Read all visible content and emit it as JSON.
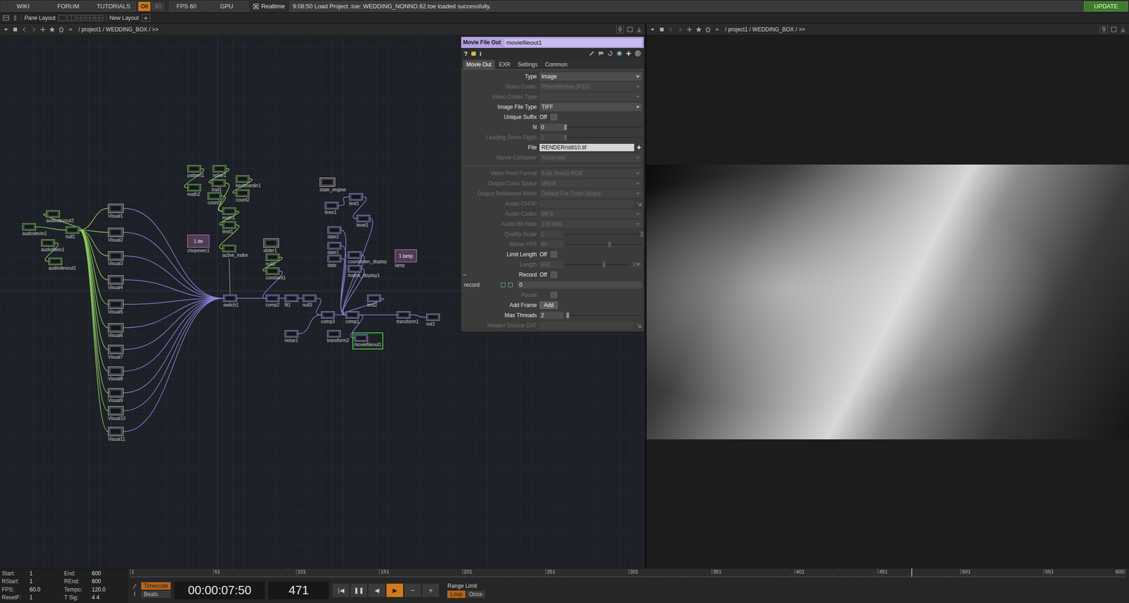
{
  "menubar": {
    "items": [
      {
        "label": "WIKI"
      },
      {
        "label": "FORUM"
      },
      {
        "label": "TUTORIALS"
      }
    ],
    "perf": {
      "badge": "OII",
      "dim": "60"
    },
    "fps": "FPS 60",
    "gpu": "GPU",
    "realtime": {
      "label": "Realtime",
      "checked": true
    },
    "status": "9:08:50 Load Project .toe: WEDDING_NONNO.62.toe loaded successfully.",
    "update": "UPDATE"
  },
  "toolbar": {
    "pane_layout": "Pane Layout",
    "new_layout": "New Layout",
    "add": "+"
  },
  "panes": [
    {
      "path": "/ project1 / WEDDING_BOX / >>",
      "counter": "0"
    },
    {
      "path": "/ project1 / WEDDING_BOX / >>",
      "counter": "0"
    }
  ],
  "network": {
    "nodes": [
      {
        "name": "audiodevout2",
        "kind": "chop",
        "selected": false
      },
      {
        "name": "audiodevin1",
        "kind": "chop",
        "selected": false
      },
      {
        "name": "null1",
        "kind": "chop",
        "selected": false
      },
      {
        "name": "audiofilein1",
        "kind": "chop",
        "selected": false
      },
      {
        "name": "audiodevout1",
        "kind": "chop",
        "selected": false
      },
      {
        "name": "Visual1",
        "kind": "comp",
        "selected": false
      },
      {
        "name": "Visual2",
        "kind": "comp",
        "selected": false
      },
      {
        "name": "Visual3",
        "kind": "comp",
        "selected": false
      },
      {
        "name": "Visual4",
        "kind": "comp",
        "selected": false
      },
      {
        "name": "Visual5",
        "kind": "comp",
        "selected": false
      },
      {
        "name": "Visual6",
        "kind": "comp",
        "selected": false
      },
      {
        "name": "Visual7",
        "kind": "comp",
        "selected": false
      },
      {
        "name": "Visual8",
        "kind": "comp",
        "selected": false
      },
      {
        "name": "Visual9",
        "kind": "comp",
        "selected": false
      },
      {
        "name": "Visual10",
        "kind": "comp",
        "selected": false
      },
      {
        "name": "Visual11",
        "kind": "comp",
        "selected": false
      },
      {
        "name": "pattern1",
        "kind": "chop",
        "selected": false
      },
      {
        "name": "noise1",
        "kind": "chop",
        "selected": false
      },
      {
        "name": "math2",
        "kind": "chop",
        "selected": false
      },
      {
        "name": "trail1",
        "kind": "chop",
        "selected": false
      },
      {
        "name": "keyboardin1",
        "kind": "chop",
        "selected": false
      },
      {
        "name": "count1",
        "kind": "chop",
        "selected": false
      },
      {
        "name": "count2",
        "kind": "chop",
        "selected": false
      },
      {
        "name": "math1",
        "kind": "chop",
        "selected": false
      },
      {
        "name": "limit1",
        "kind": "chop",
        "selected": false
      },
      {
        "name": "chopexec1",
        "kind": "dat",
        "selected": false,
        "viewer": "1 de"
      },
      {
        "name": "active_index",
        "kind": "chop",
        "selected": false
      },
      {
        "name": "slider1",
        "kind": "comp",
        "selected": false
      },
      {
        "name": "null2",
        "kind": "chop",
        "selected": false
      },
      {
        "name": "constant1",
        "kind": "chop",
        "selected": false
      },
      {
        "name": "switch1",
        "kind": "top",
        "selected": false
      },
      {
        "name": "comp2",
        "kind": "top",
        "selected": false
      },
      {
        "name": "fit1",
        "kind": "top",
        "selected": false
      },
      {
        "name": "null3",
        "kind": "top",
        "selected": false
      },
      {
        "name": "comp3",
        "kind": "top",
        "selected": false
      },
      {
        "name": "comp1",
        "kind": "top",
        "selected": false
      },
      {
        "name": "noise1",
        "kind": "top",
        "selected": false
      },
      {
        "name": "transform2",
        "kind": "top",
        "selected": false
      },
      {
        "name": "moviefileout1",
        "kind": "top",
        "selected": true
      },
      {
        "name": "state_engine",
        "kind": "comp",
        "selected": false
      },
      {
        "name": "lines1",
        "kind": "top",
        "selected": false
      },
      {
        "name": "text1",
        "kind": "top",
        "selected": false
      },
      {
        "name": "level1",
        "kind": "top",
        "selected": false
      },
      {
        "name": "date2",
        "kind": "top",
        "selected": false
      },
      {
        "name": "date1",
        "kind": "top",
        "selected": false
      },
      {
        "name": "date",
        "kind": "top",
        "selected": false
      },
      {
        "name": "countdown_display",
        "kind": "top",
        "selected": false
      },
      {
        "name": "lamp",
        "kind": "dat",
        "selected": false,
        "viewer": "1 lamp"
      },
      {
        "name": "matrix_display1",
        "kind": "top",
        "selected": false
      },
      {
        "name": "text2",
        "kind": "top",
        "selected": false
      },
      {
        "name": "transform1",
        "kind": "top",
        "selected": false
      },
      {
        "name": "out1",
        "kind": "top",
        "selected": false
      }
    ]
  },
  "params": {
    "type_label": "Movie File Out",
    "name": "moviefileout1",
    "help": "?",
    "info": "i",
    "tabs": [
      {
        "label": "Movie Out",
        "selected": true
      },
      {
        "label": "EXR",
        "selected": false
      },
      {
        "label": "Settings",
        "selected": false
      },
      {
        "label": "Common",
        "selected": false
      }
    ],
    "rows": [
      {
        "label": "Type",
        "kind": "menu",
        "value": "Image",
        "disabled": false
      },
      {
        "label": "Video Codec",
        "kind": "menu",
        "value": "Photo/Motion JPEG",
        "disabled": true
      },
      {
        "label": "Video Codec Type",
        "kind": "menu",
        "value": "",
        "disabled": true
      },
      {
        "label": "Image File Type",
        "kind": "menu",
        "value": "TIFF",
        "disabled": false
      },
      {
        "label": "Unique Suffix",
        "kind": "toggle",
        "value": "Off",
        "on": false,
        "disabled": false
      },
      {
        "label": "N",
        "kind": "slider",
        "value": "0",
        "level": 0,
        "disabled": false
      },
      {
        "label": "Leading Zeros Digits",
        "kind": "slider",
        "value": "1",
        "level": 0,
        "disabled": true
      },
      {
        "label": "File",
        "kind": "file",
        "value": "RENDER/still10.tif",
        "button": "+",
        "disabled": false
      },
      {
        "label": "Movie Container",
        "kind": "menu",
        "value": "Automatic",
        "disabled": true
      },
      {
        "kind": "separator"
      },
      {
        "label": "Video Pixel Format",
        "kind": "menu",
        "value": "8-bit (fixed) RGB",
        "disabled": true
      },
      {
        "label": "Output Color Space",
        "kind": "menu",
        "value": "sRGB",
        "disabled": true
      },
      {
        "label": "Output Reference White",
        "kind": "menu",
        "value": "Default For Color Space",
        "disabled": true
      },
      {
        "label": "Audio CHOP",
        "kind": "chop",
        "value": "",
        "disabled": true
      },
      {
        "label": "Audio Codec",
        "kind": "menu",
        "value": "MP3",
        "disabled": true
      },
      {
        "label": "Audio Bit Rate",
        "kind": "menu",
        "value": "128 kb/s",
        "disabled": true
      },
      {
        "label": "Quality Scale",
        "kind": "slider",
        "value": "1",
        "level": 1,
        "disabled": true
      },
      {
        "label": "Movie FPS",
        "kind": "slider",
        "value": "60",
        "level": 0.58,
        "disabled": true
      },
      {
        "label": "Limit Length",
        "kind": "toggle",
        "value": "Off",
        "on": false,
        "disabled": false
      },
      {
        "label": "Length",
        "kind": "slider",
        "value": "600",
        "level": 0.6,
        "unit": "I",
        "disabled": true
      },
      {
        "label": "Record",
        "kind": "toggle",
        "value": "Off",
        "on": false,
        "marker": "–",
        "disabled": false
      },
      {
        "label": "record",
        "kind": "expr",
        "value": "0",
        "checks": [
          false,
          false
        ],
        "disabled": false
      },
      {
        "label": "Pause",
        "kind": "toggle",
        "value": "",
        "on": false,
        "disabled": true
      },
      {
        "label": "Add Frame",
        "kind": "button",
        "value": "Add",
        "disabled": false
      },
      {
        "label": "Max Threads",
        "kind": "slider",
        "value": "2",
        "level": 0.03,
        "disabled": false
      },
      {
        "label": "Header Source DAT",
        "kind": "chop",
        "value": "",
        "disabled": true
      }
    ]
  },
  "timeline": {
    "info": [
      {
        "label": "Start:",
        "value": "1"
      },
      {
        "label": "End:",
        "value": "600"
      },
      {
        "label": "RStart:",
        "value": "1"
      },
      {
        "label": "REnd:",
        "value": "600"
      },
      {
        "label": "FPS:",
        "value": "60.0"
      },
      {
        "label": "Tempo:",
        "value": "120.0"
      },
      {
        "label": "ResetF:",
        "value": "1"
      },
      {
        "label": "T Sig:",
        "value": "4 4"
      }
    ],
    "ruler": [
      "1",
      "51",
      "101",
      "151",
      "201",
      "251",
      "301",
      "351",
      "401",
      "451",
      "501",
      "551",
      "600"
    ],
    "playhead": 0.785,
    "modes": [
      {
        "label": "Timecode",
        "selected": true
      },
      {
        "label": "Beats",
        "selected": false
      }
    ],
    "time": "00:00:07:50",
    "frame": "471",
    "transport": [
      {
        "label": "|◀",
        "selected": false
      },
      {
        "label": "❚❚",
        "selected": false
      },
      {
        "label": "◀",
        "selected": false
      },
      {
        "label": "▶",
        "selected": true
      },
      {
        "label": "−",
        "selected": false
      },
      {
        "label": "+",
        "selected": false
      }
    ],
    "range_limit": "Range Limit",
    "range": [
      {
        "label": "Loop",
        "selected": true
      },
      {
        "label": "Once",
        "selected": false
      }
    ]
  }
}
